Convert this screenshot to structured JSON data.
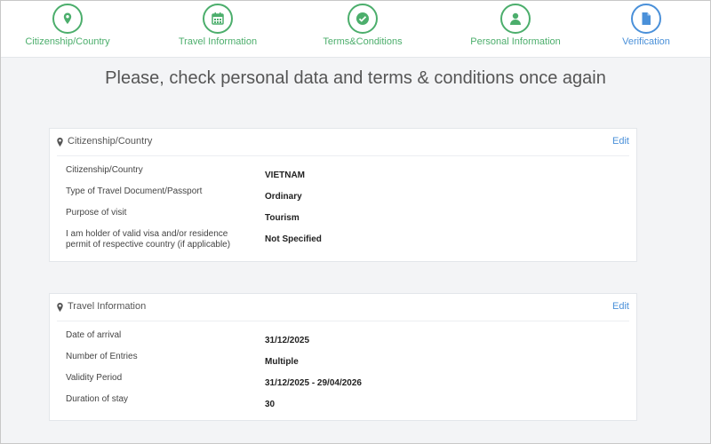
{
  "steps": [
    {
      "label": "Citizenship/Country",
      "icon": "map-pin-icon"
    },
    {
      "label": "Travel Information",
      "icon": "calendar-icon"
    },
    {
      "label": "Terms&Conditions",
      "icon": "check-icon"
    },
    {
      "label": "Personal Information",
      "icon": "user-icon"
    },
    {
      "label": "Verification",
      "icon": "document-icon"
    }
  ],
  "colors": {
    "done": "#4cae6c",
    "current": "#4a90d9"
  },
  "heading": "Please, check personal data and terms & conditions once again",
  "citizenship_card": {
    "title": "Citizenship/Country",
    "edit": "Edit",
    "rows": [
      {
        "label": "Citizenship/Country",
        "value": "VIETNAM"
      },
      {
        "label": "Type of Travel Document/Passport",
        "value": "Ordinary"
      },
      {
        "label": "Purpose of visit",
        "value": "Tourism"
      },
      {
        "label": "I am holder of valid visa and/or residence permit of respective country (if applicable)",
        "value": "Not Specified"
      }
    ]
  },
  "travel_card": {
    "title": "Travel Information",
    "edit": "Edit",
    "rows": [
      {
        "label": "Date of arrival",
        "value": "31/12/2025"
      },
      {
        "label": "Number of Entries",
        "value": "Multiple"
      },
      {
        "label": "Validity Period",
        "value": "31/12/2025 - 29/04/2026"
      },
      {
        "label": "Duration of stay",
        "value": "30"
      }
    ]
  }
}
